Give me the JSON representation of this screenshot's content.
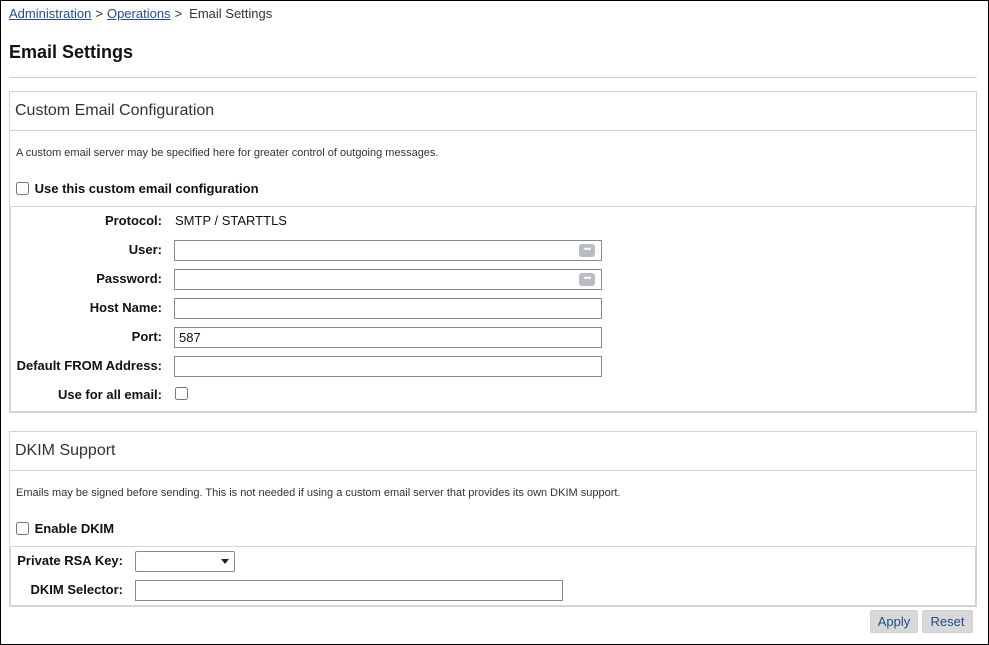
{
  "breadcrumb": {
    "items": [
      "Administration",
      "Operations"
    ],
    "separator": ">",
    "current": "Email Settings"
  },
  "page": {
    "title": "Email Settings"
  },
  "custom_email": {
    "title": "Custom Email Configuration",
    "description": "A custom email server may be specified here for greater control of outgoing messages.",
    "enable_label": "Use this custom email configuration",
    "enabled": false,
    "fields": {
      "protocol": {
        "label": "Protocol:",
        "value": "SMTP / STARTTLS"
      },
      "user": {
        "label": "User:",
        "value": "",
        "icon": "password-manager-icon"
      },
      "password": {
        "label": "Password:",
        "value": "",
        "icon": "password-manager-icon"
      },
      "host": {
        "label": "Host Name:",
        "value": ""
      },
      "port": {
        "label": "Port:",
        "value": "587"
      },
      "from": {
        "label": "Default FROM Address:",
        "value": ""
      },
      "use_all": {
        "label": "Use for all email:",
        "checked": false
      }
    }
  },
  "dkim": {
    "title": "DKIM Support",
    "description": "Emails may be signed before sending. This is not needed if using a custom email server that provides its own DKIM support.",
    "enable_label": "Enable DKIM",
    "enabled": false,
    "fields": {
      "rsa_key": {
        "label": "Private RSA Key:",
        "selected": ""
      },
      "selector": {
        "label": "DKIM Selector:",
        "value": ""
      }
    }
  },
  "actions": {
    "apply": "Apply",
    "reset": "Reset"
  },
  "colors": {
    "link": "#1f4d8c",
    "border": "#d4d4d4",
    "button_bg": "#d8d8d8"
  }
}
